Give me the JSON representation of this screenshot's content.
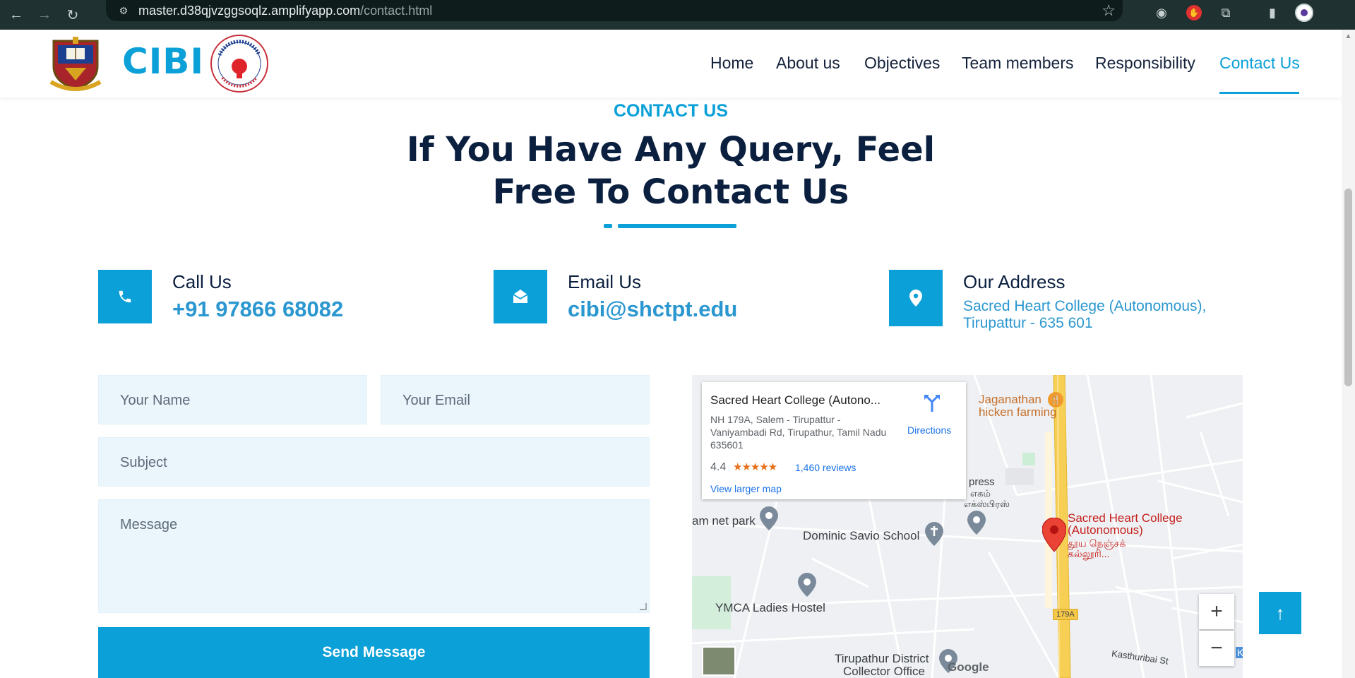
{
  "browser": {
    "url_host": "master.d38qjvzggsoqlz.amplifyapp.com",
    "url_path": "/contact.html"
  },
  "header": {
    "brand": "CIBI",
    "nav": [
      {
        "label": "Home"
      },
      {
        "label": "About us"
      },
      {
        "label": "Objectives"
      },
      {
        "label": "Team members"
      },
      {
        "label": "Responsibility"
      },
      {
        "label": "Contact Us",
        "active": true
      }
    ]
  },
  "hero": {
    "kicker": "CONTACT US",
    "headline": "If You Have Any Query, Feel Free To Contact Us"
  },
  "contacts": {
    "call": {
      "title": "Call Us",
      "value": "+91 97866 68082",
      "icon": "phone-icon"
    },
    "email": {
      "title": "Email Us",
      "value": "cibi@shctpt.edu",
      "icon": "envelope-open-icon"
    },
    "address": {
      "title": "Our Address",
      "line1": "Sacred Heart College (Autonomous),",
      "line2": "Tirupattur - 635 601",
      "icon": "map-marker-icon"
    }
  },
  "form": {
    "name_placeholder": "Your Name",
    "email_placeholder": "Your Email",
    "subject_placeholder": "Subject",
    "message_placeholder": "Message",
    "submit_label": "Send Message"
  },
  "map": {
    "place_name": "Sacred Heart College (Autono...",
    "place_address": "NH 179A, Salem - Tirupattur - Vaniyambadi Rd, Tirupathur, Tamil Nadu 635601",
    "rating": "4.4",
    "stars": "★★★★★",
    "reviews": "1,460 reviews",
    "directions_label": "Directions",
    "view_larger": "View larger map",
    "labels": {
      "restaurant_1": "Jaganathan",
      "restaurant_2": "hicken farming",
      "express_1": "press",
      "express_2": "எகம்",
      "express_3": "எக்ஸ்பிரஸ்",
      "park": "am net park",
      "school": "Dominic Savio School",
      "college_1": "Sacred Heart College",
      "college_2": "(Autonomous)",
      "college_3": "தூய நெஞ்சக்",
      "college_4": "கல்லூரி...",
      "hostel": "YMCA Ladies Hostel",
      "collector_1": "Tirupathur District",
      "collector_2": "Collector Office",
      "road_badge": "179A",
      "street": "Kasthuribai St",
      "edge_k": "K",
      "google": "Google"
    },
    "zoom_in": "+",
    "zoom_out": "−"
  },
  "back_to_top": "↑",
  "colors": {
    "accent": "#0ba0d8",
    "navy": "#0b1f3f",
    "field_bg": "#eaf6fc"
  }
}
